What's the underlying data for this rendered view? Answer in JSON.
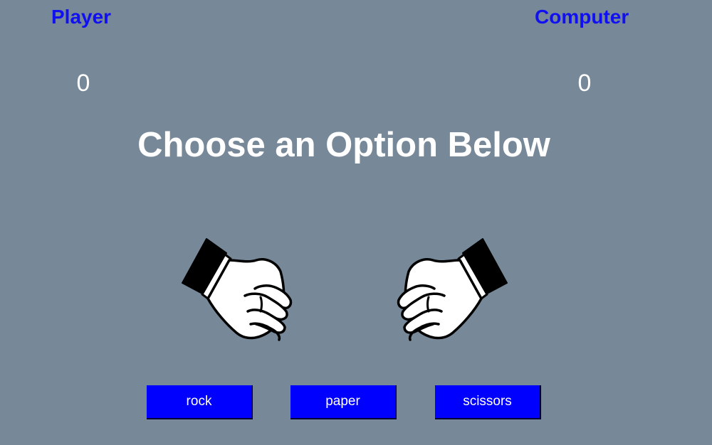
{
  "scoreboard": {
    "player_label": "Player",
    "computer_label": "Computer",
    "player_score": "0",
    "computer_score": "0"
  },
  "message": "Choose an Option Below",
  "hands": {
    "player": "fist-icon",
    "computer": "fist-icon"
  },
  "choices": [
    {
      "label": "rock"
    },
    {
      "label": "paper"
    },
    {
      "label": "scissors"
    }
  ],
  "colors": {
    "background": "#778899",
    "label": "#1010f0",
    "button": "#0000ff",
    "text": "#ffffff"
  }
}
